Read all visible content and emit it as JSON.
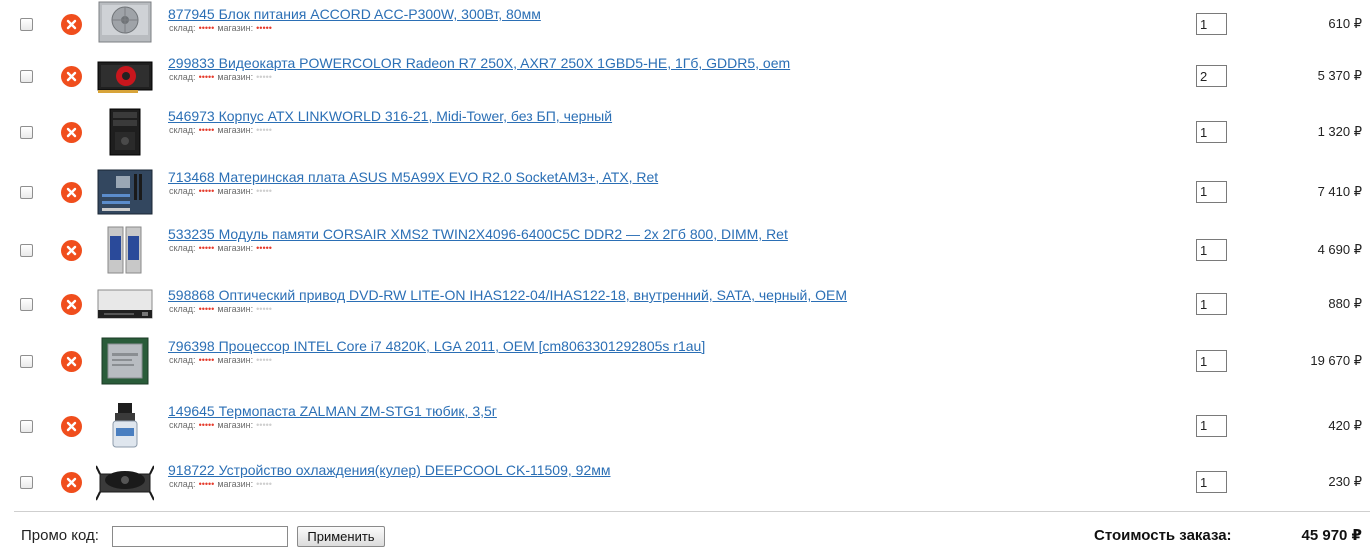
{
  "cart": {
    "items": [
      {
        "name": "877945 Блок питания ACCORD ACC-P300W, 300Вт, 80мм",
        "quantity": "1",
        "price": "610 ₽",
        "stock_level": "available",
        "store_level": "available",
        "image_icon": "power-supply-icon"
      },
      {
        "name": "299833 Видеокарта POWERCOLOR Radeon R7 250X, AXR7 250X 1GBD5-HE, 1Гб, GDDR5, oem",
        "quantity": "2",
        "price": "5 370 ₽",
        "stock_level": "available",
        "store_level": "unavailable",
        "image_icon": "graphics-card-icon"
      },
      {
        "name": "546973 Корпус ATX LINKWORLD 316-21, Midi-Tower, без БП, черный",
        "quantity": "1",
        "price": "1 320 ₽",
        "stock_level": "available",
        "store_level": "unavailable",
        "image_icon": "pc-case-icon"
      },
      {
        "name": "713468 Материнская плата ASUS M5A99X EVO R2.0 SocketAM3+, ATX, Ret",
        "quantity": "1",
        "price": "7 410 ₽",
        "stock_level": "available",
        "store_level": "unavailable",
        "image_icon": "motherboard-icon"
      },
      {
        "name": "533235 Модуль памяти CORSAIR XMS2 TWIN2X4096-6400C5C DDR2 — 2x 2Гб 800, DIMM, Ret",
        "quantity": "1",
        "price": "4 690 ₽",
        "stock_level": "available",
        "store_level": "available",
        "image_icon": "memory-module-icon"
      },
      {
        "name": "598868 Оптический привод DVD-RW LITE-ON IHAS122-04/IHAS122-18, внутренний, SATA, черный, OEM",
        "quantity": "1",
        "price": "880 ₽",
        "stock_level": "available",
        "store_level": "unavailable",
        "image_icon": "optical-drive-icon"
      },
      {
        "name": "796398 Процессор INTEL Core i7 4820K, LGA 2011, OEM [cm8063301292805s r1au]",
        "quantity": "1",
        "price": "19 670 ₽",
        "stock_level": "available",
        "store_level": "unavailable",
        "image_icon": "processor-icon"
      },
      {
        "name": "149645 Термопаста ZALMAN ZM-STG1 тюбик, 3,5г",
        "quantity": "1",
        "price": "420 ₽",
        "stock_level": "available",
        "store_level": "unavailable",
        "image_icon": "thermal-paste-icon"
      },
      {
        "name": "918722 Устройство охлаждения(кулер) DEEPCOOL CK-11509, 92мм",
        "quantity": "1",
        "price": "230 ₽",
        "stock_level": "available",
        "store_level": "unavailable",
        "image_icon": "cpu-cooler-icon"
      }
    ],
    "availability_labels": {
      "stock": "склад:",
      "store": "магазин:"
    },
    "availability_dots": {
      "available": "•••••",
      "unavailable": "•••••"
    },
    "remove_icon": "remove-x-icon"
  },
  "footer": {
    "promo_label": "Промо код:",
    "promo_value": "",
    "apply_label": "Применить",
    "total_label": "Стоимость заказа:",
    "total_value": "45 970 ₽"
  },
  "colors": {
    "link": "#2b6fb5",
    "remove": "#f04e1d",
    "dot_available": "#e53b2c",
    "dot_unavailable": "#cfcfcf"
  }
}
